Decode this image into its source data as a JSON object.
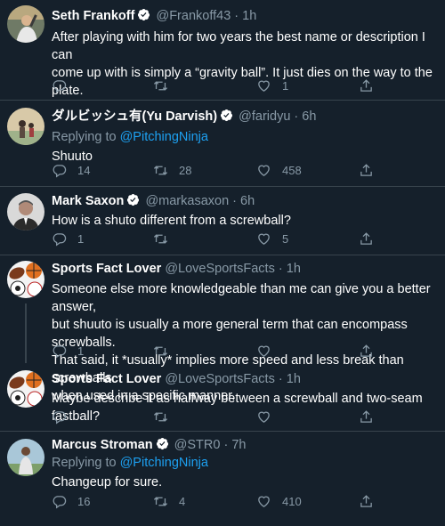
{
  "tweets": [
    {
      "name": "Seth Frankoff",
      "handle": "@Frankoff43",
      "time": "1h",
      "verified": true,
      "text": [
        "After playing with him for two years the best name or description I can",
        "come up with is simply a “gravity ball”. It just dies on the way to the plate."
      ],
      "replies": "",
      "retweets": "",
      "likes": "1"
    },
    {
      "name": "ダルビッシュ有(Yu Darvish)",
      "handle": "@faridyu",
      "time": "6h",
      "verified": true,
      "replying_label": "Replying to",
      "replying_to": "@PitchingNinja",
      "text": [
        "Shuuto"
      ],
      "replies": "14",
      "retweets": "28",
      "likes": "458"
    },
    {
      "name": "Mark Saxon",
      "handle": "@markasaxon",
      "time": "6h",
      "verified": true,
      "text": [
        "How is a shuto different from a screwball?"
      ],
      "replies": "1",
      "retweets": "",
      "likes": "5"
    },
    {
      "name": "Sports Fact Lover",
      "handle": "@LoveSportsFacts",
      "time": "1h",
      "verified": false,
      "text": [
        "Someone else more knowledgeable than me can give you a better answer,",
        "but shuuto is usually a more general term that can encompass screwballs.",
        "That said, it *usually* implies more speed and less break than screwballs",
        "when used in a specific manner."
      ],
      "replies": "1",
      "retweets": "",
      "likes": ""
    },
    {
      "name": "Sports Fact Lover",
      "handle": "@LoveSportsFacts",
      "time": "1h",
      "verified": false,
      "text": [
        "Maybe describe it as halfway between a screwball and two-seam fastball?"
      ],
      "replies": "",
      "retweets": "",
      "likes": ""
    },
    {
      "name": "Marcus Stroman",
      "handle": "@STR0",
      "time": "7h",
      "verified": true,
      "replying_label": "Replying to",
      "replying_to": "@PitchingNinja",
      "text": [
        "Changeup for sure."
      ],
      "replies": "16",
      "retweets": "4",
      "likes": "410"
    }
  ],
  "separator": "·",
  "icons": {
    "reply": "reply-icon",
    "retweet": "retweet-icon",
    "like": "heart-icon",
    "share": "share-icon",
    "verified": "verified-badge-icon"
  },
  "colors": {
    "background": "#15202b",
    "secondary_text": "#8899a6",
    "link": "#1da1f2",
    "divider": "#38444d"
  }
}
